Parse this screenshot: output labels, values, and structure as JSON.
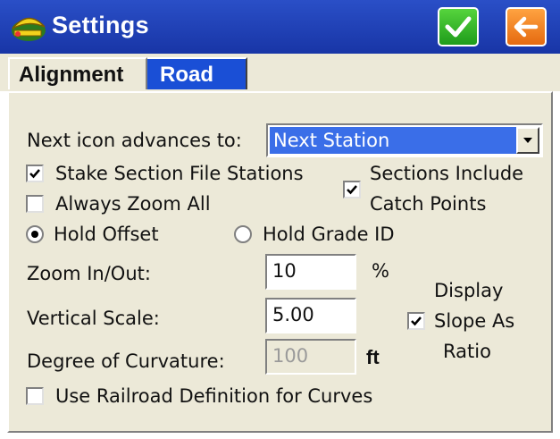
{
  "window": {
    "title": "Settings",
    "ok_icon": "checkmark-icon",
    "back_icon": "back-arrow-icon",
    "colors": {
      "titlebar": "#1f3fb8",
      "ok": "#2fb52a",
      "back": "#f28a2a",
      "active_tab": "#1a4fd6"
    }
  },
  "tabs": [
    {
      "label": "Alignment",
      "active": false
    },
    {
      "label": "Road",
      "active": true
    }
  ],
  "form": {
    "next_icon_label": "Next icon advances to:",
    "next_icon_value": "Next Station",
    "stake_section_label": "Stake Section File Stations",
    "stake_section_checked": true,
    "sections_include_line1": "Sections Include",
    "sections_include_line2": "Catch Points",
    "sections_include_checked": true,
    "always_zoom_label": "Always Zoom All",
    "always_zoom_checked": false,
    "hold_offset_label": "Hold Offset",
    "hold_offset_selected": true,
    "hold_grade_label": "Hold Grade ID",
    "hold_grade_selected": false,
    "zoom_label": "Zoom In/Out:",
    "zoom_value": "10",
    "zoom_unit": "%",
    "vertical_scale_label": "Vertical Scale:",
    "vertical_scale_value": "5.00",
    "degree_curvature_label": "Degree of Curvature:",
    "degree_curvature_value": "100",
    "degree_curvature_unit": "ft",
    "display_slope_line1": "Display",
    "display_slope_line2": "Slope As",
    "display_slope_line3": "Ratio",
    "display_slope_checked": true,
    "railroad_label": "Use Railroad Definition for Curves",
    "railroad_checked": false
  }
}
